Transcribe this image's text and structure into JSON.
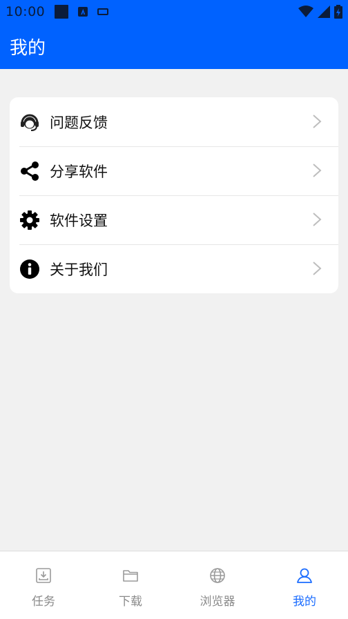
{
  "status_bar": {
    "time": "10:00"
  },
  "app_bar": {
    "title": "我的"
  },
  "menu": {
    "items": [
      {
        "label": "问题反馈",
        "icon": "headset-icon"
      },
      {
        "label": "分享软件",
        "icon": "share-icon"
      },
      {
        "label": "软件设置",
        "icon": "gear-icon"
      },
      {
        "label": "关于我们",
        "icon": "info-icon"
      }
    ]
  },
  "bottom_nav": {
    "items": [
      {
        "label": "任务",
        "icon": "download-tray-icon"
      },
      {
        "label": "下载",
        "icon": "folder-icon"
      },
      {
        "label": "浏览器",
        "icon": "globe-icon"
      },
      {
        "label": "我的",
        "icon": "person-icon",
        "active": true
      }
    ]
  },
  "colors": {
    "primary": "#0062ff",
    "active_nav": "#1a6cff",
    "background": "#f1f1f1"
  }
}
